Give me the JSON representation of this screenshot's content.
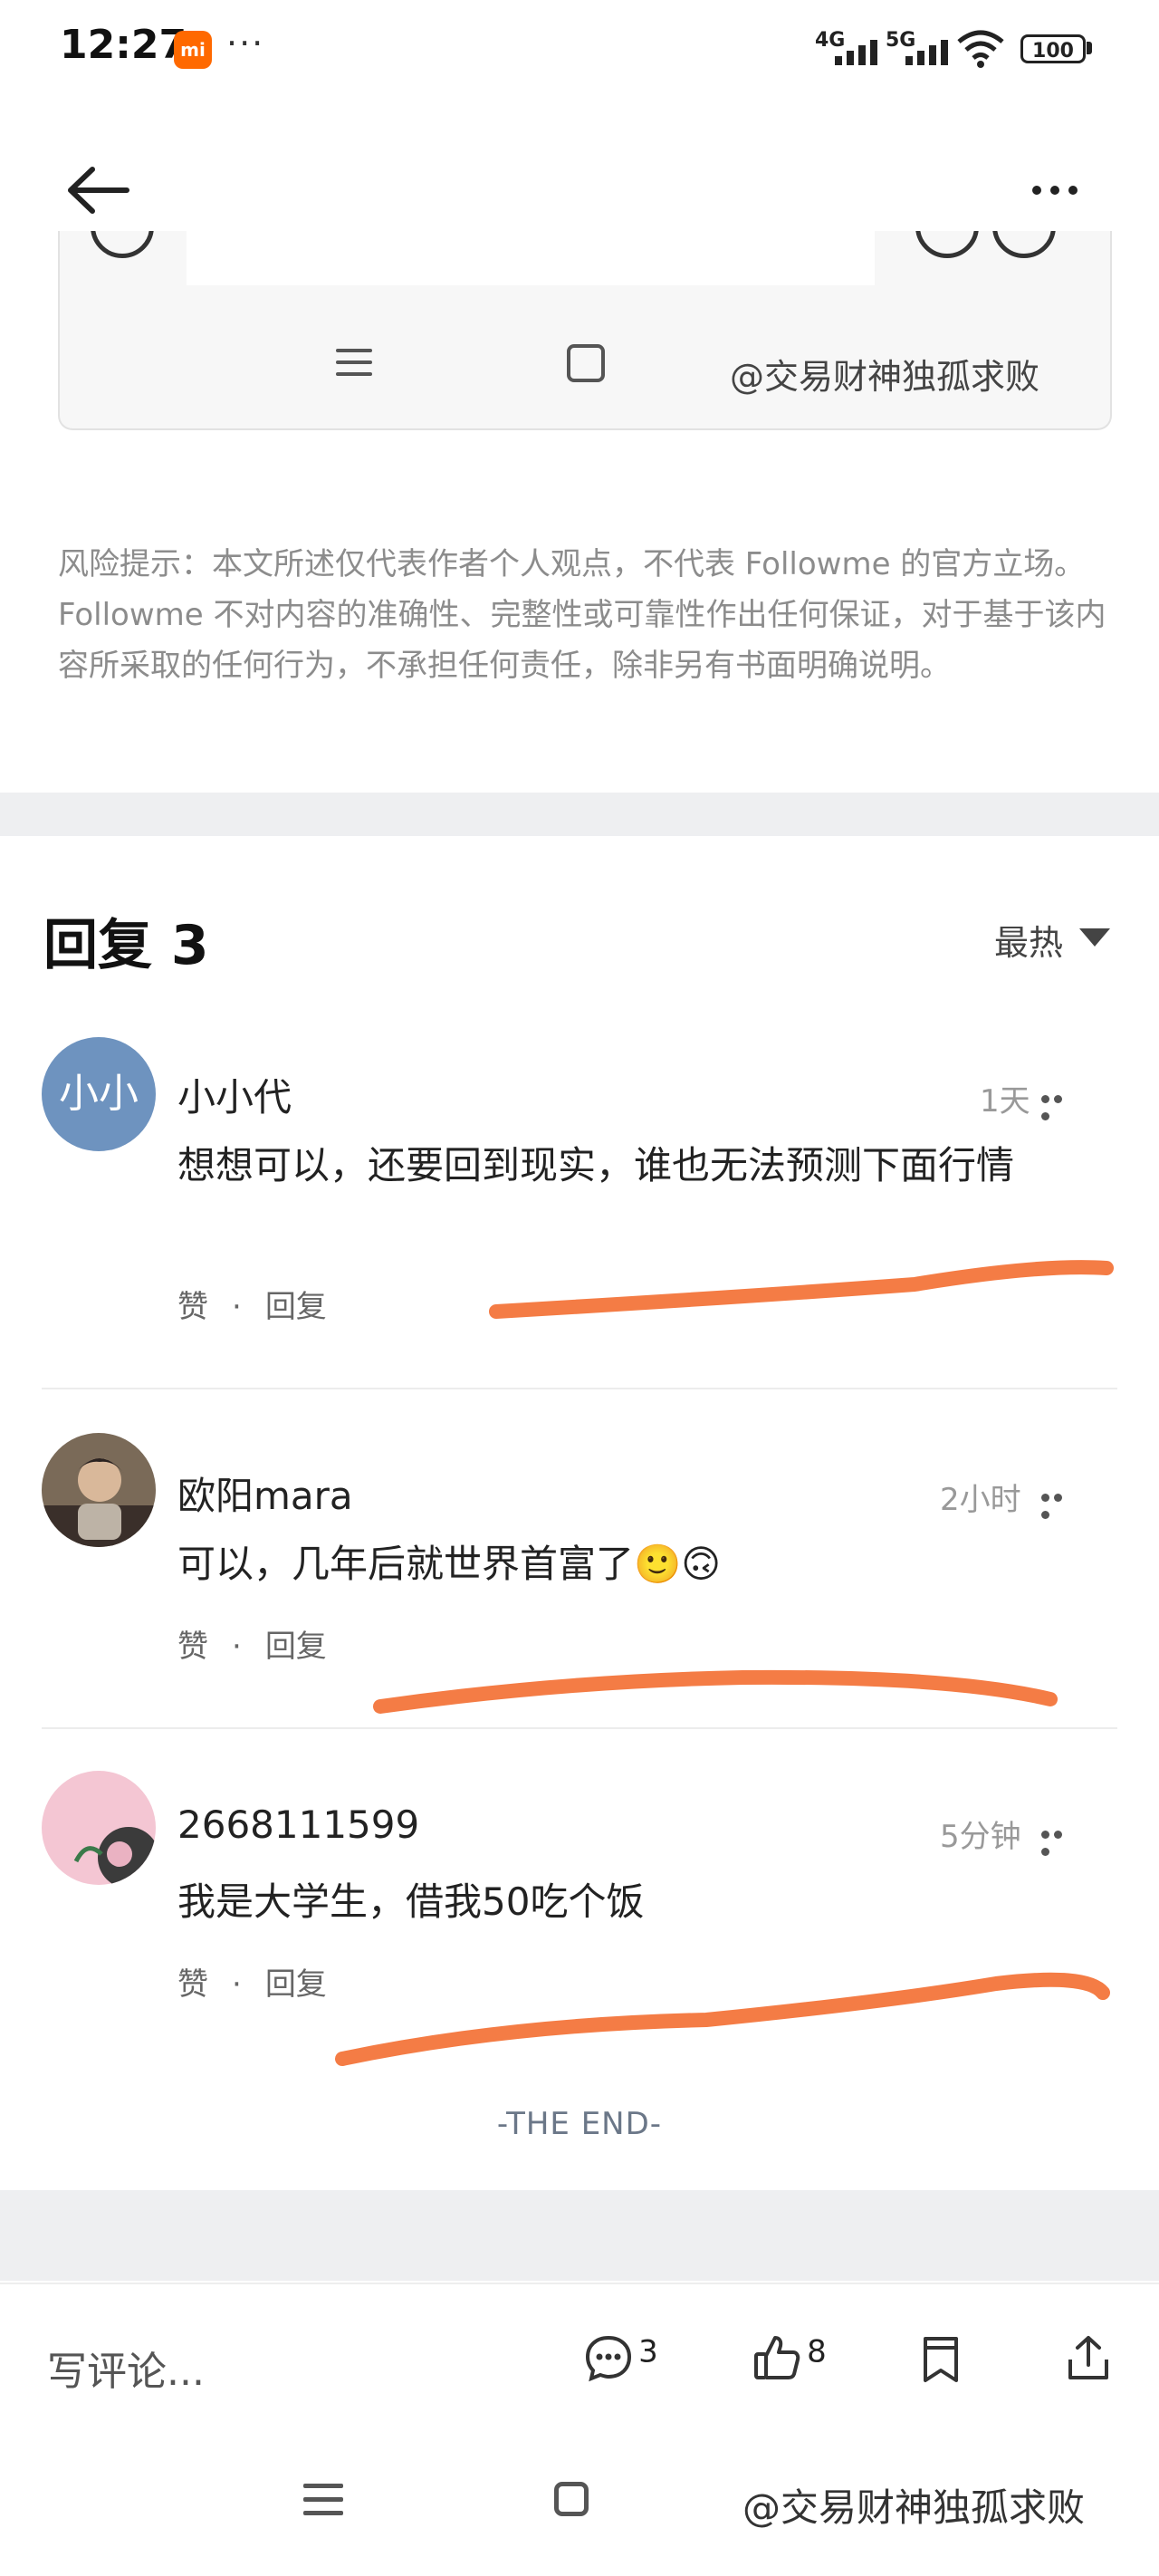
{
  "status_bar": {
    "time": "12:27",
    "carrier_badge": "mi",
    "more_dots": "···",
    "signal_1": "4G",
    "signal_2": "5G",
    "battery": "100"
  },
  "image_card": {
    "watermark": "@交易财神独孤求败"
  },
  "disclaimer": "风险提示：本文所述仅代表作者个人观点，不代表 Followme 的官方立场。Followme 不对内容的准确性、完整性或可靠性作出任何保证，对于基于该内容所采取的任何行为，不承担任何责任，除非另有书面明确说明。",
  "replies": {
    "title": "回复 3",
    "sort_label": "最热",
    "items": [
      {
        "name": "小小代",
        "avatar_text": "小小",
        "time": "1天",
        "text": "想想可以，还要回到现实，谁也无法预测下面行情",
        "like": "赞",
        "reply": "回复"
      },
      {
        "name": "欧阳mara",
        "time": "2小时",
        "text": "可以，几年后就世界首富了🙂🙃",
        "like": "赞",
        "reply": "回复"
      },
      {
        "name": "2668111599",
        "time": "5分钟",
        "text": "我是大学生，借我50吃个饭",
        "like": "赞",
        "reply": "回复"
      }
    ],
    "end_marker": "-THE END-"
  },
  "bottom_bar": {
    "write_placeholder": "写评论...",
    "comment_count": "3",
    "like_count": "8"
  },
  "nav_bar": {
    "watermark": "@交易财神独孤求败"
  },
  "colors": {
    "highlight_stroke": "#f47c45",
    "avatar_1": "#6e93bf"
  }
}
